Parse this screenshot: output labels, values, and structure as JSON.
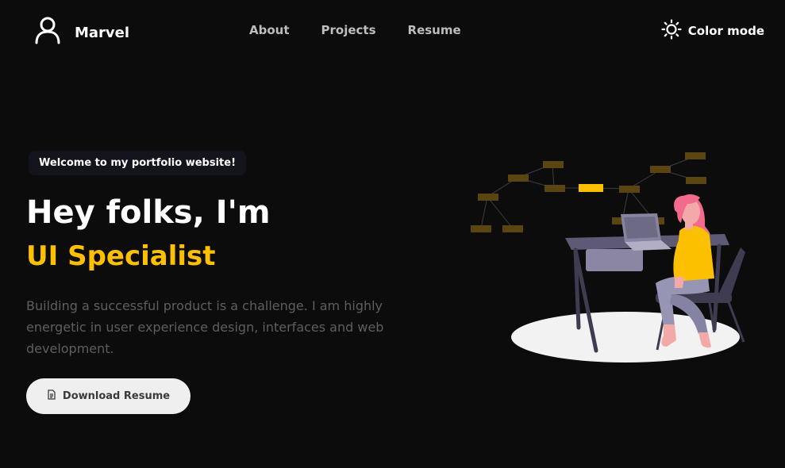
{
  "header": {
    "brand": "Marvel",
    "nav": [
      {
        "label": "About"
      },
      {
        "label": "Projects"
      },
      {
        "label": "Resume"
      }
    ],
    "color_mode_label": "Color mode",
    "icons": {
      "brand": "user-icon",
      "color_mode": "sun-icon"
    }
  },
  "hero": {
    "welcome_badge": "Welcome to my portfolio website!",
    "headline": "Hey folks, I'm",
    "role": "UI Specialist",
    "intro": "Building a successful product is a challenge. I am highly energetic in user experience design, interfaces and web development.",
    "download_button": "Download Resume",
    "download_icon": "document-icon"
  },
  "colors": {
    "background": "#0c0c0c",
    "accent": "#fcc000",
    "text_primary": "#ffffff",
    "text_muted": "#5e5e5e",
    "button_bg": "#efefef"
  }
}
